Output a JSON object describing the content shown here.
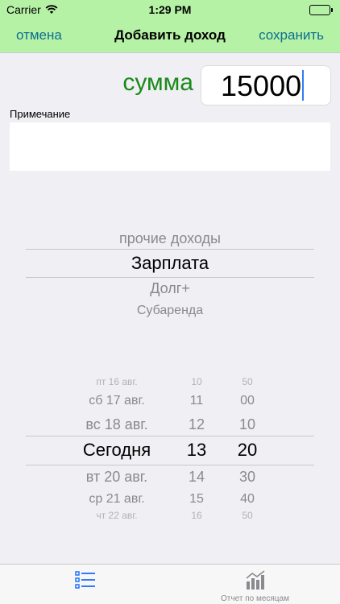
{
  "status_bar": {
    "carrier": "Carrier",
    "time": "1:29 PM"
  },
  "nav": {
    "cancel": "отмена",
    "title": "Добавить доход",
    "save": "сохранить"
  },
  "form": {
    "sum_label": "сумма",
    "sum_value": "15000",
    "note_label": "Примечание",
    "note_value": ""
  },
  "category_picker": {
    "items": [
      "прочие доходы",
      "Зарплата",
      "Долг+",
      "Субаренда"
    ],
    "selected_index": 1
  },
  "date_picker": {
    "rows": [
      {
        "date": "пт 16 авг.",
        "hour": "10",
        "minute": "50"
      },
      {
        "date": "сб 17 авг.",
        "hour": "11",
        "minute": "00"
      },
      {
        "date": "вс 18 авг.",
        "hour": "12",
        "minute": "10"
      },
      {
        "date": "Сегодня",
        "hour": "13",
        "minute": "20"
      },
      {
        "date": "вт 20 авг.",
        "hour": "14",
        "minute": "30"
      },
      {
        "date": "ср 21 авг.",
        "hour": "15",
        "minute": "40"
      },
      {
        "date": "чт 22 авг.",
        "hour": "16",
        "minute": "50"
      }
    ],
    "selected_index": 3
  },
  "tab_bar": {
    "tabs": [
      {
        "label": "",
        "icon": "list-icon",
        "active": true,
        "color": "#2f7cf6"
      },
      {
        "label": "Отчет по месяцам",
        "icon": "bar-chart-icon",
        "active": false,
        "color": "#8a8a8e"
      }
    ]
  },
  "colors": {
    "nav_background": "#b6f2a6",
    "nav_button": "#0b6f8f",
    "sum_label": "#1a8a1a",
    "caret": "#2f7cf6"
  }
}
